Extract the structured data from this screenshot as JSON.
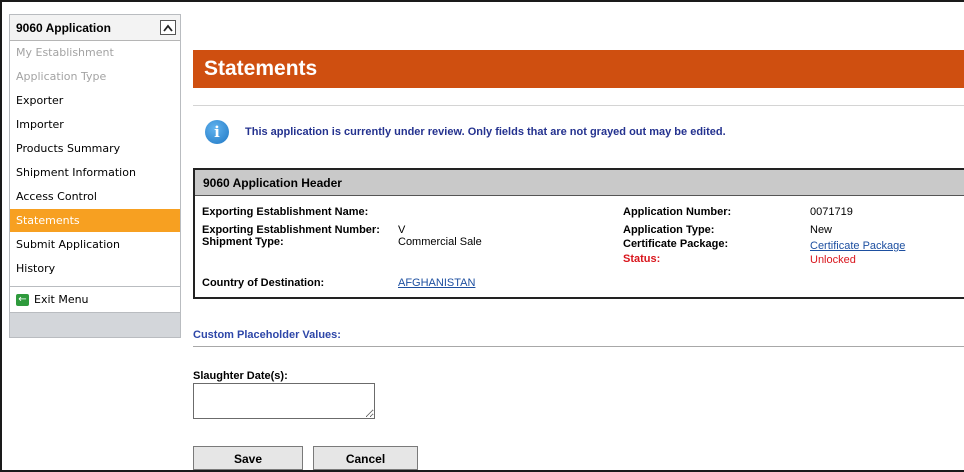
{
  "sidebar": {
    "title": "9060 Application",
    "collapse_glyph": "^",
    "items": [
      {
        "label": "My Establishment"
      },
      {
        "label": "Application Type"
      },
      {
        "label": "Exporter"
      },
      {
        "label": "Importer"
      },
      {
        "label": "Products Summary"
      },
      {
        "label": "Shipment Information"
      },
      {
        "label": "Access Control"
      },
      {
        "label": "Statements"
      },
      {
        "label": "Submit Application"
      },
      {
        "label": "History"
      }
    ],
    "exit_label": "Exit Menu",
    "exit_icon": "exit-arrow-icon"
  },
  "page": {
    "title": "Statements",
    "info_message": "This application is currently under review. Only fields that are not grayed out may be edited.",
    "info_icon_glyph": "i"
  },
  "header": {
    "title": "9060 Application Header",
    "exporting_establishment_name_label": "Exporting Establishment Name:",
    "exporting_establishment_name_value": "",
    "exporting_establishment_number_label": "Exporting Establishment Number:",
    "exporting_establishment_number_value": "V",
    "shipment_type_label": "Shipment Type:",
    "shipment_type_value": "Commercial Sale",
    "country_label": "Country of Destination:",
    "country_value": "AFGHANISTAN",
    "application_number_label": "Application Number:",
    "application_number_value": "0071719",
    "application_type_label": "Application Type:",
    "application_type_value": "New",
    "certificate_package_label": "Certificate Package:",
    "certificate_package_value": "Certificate Package",
    "status_label": "Status:",
    "status_value": "Unlocked"
  },
  "custom": {
    "section_label": "Custom Placeholder Values:",
    "slaughter_label": "Slaughter Date(s):",
    "slaughter_value": ""
  },
  "buttons": {
    "save": "Save",
    "cancel": "Cancel"
  },
  "colors": {
    "title_bar": "#cf4f10",
    "active_nav": "#f7a021",
    "status_red": "#d9151c",
    "link_blue": "#1d4fa0",
    "info_text": "#24328f"
  }
}
